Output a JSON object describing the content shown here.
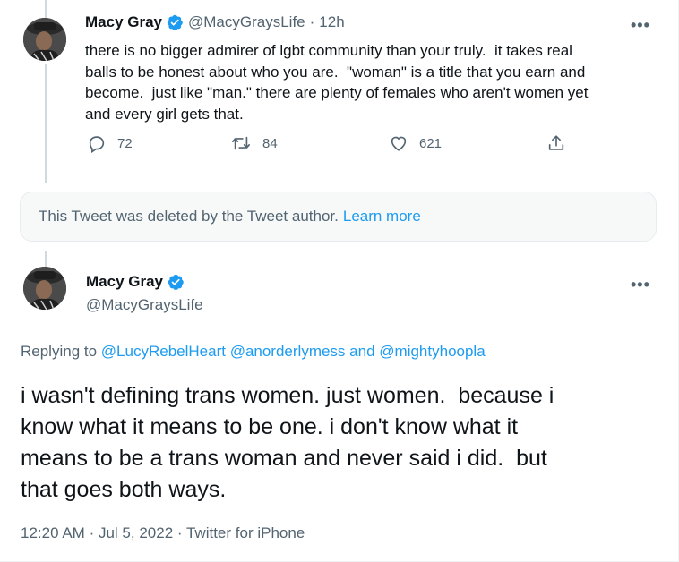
{
  "tweet1": {
    "name": "Macy Gray",
    "handle": "@MacyGraysLife",
    "separator": "·",
    "time": "12h",
    "more": "•••",
    "text_lines": [
      "there is no bigger admirer of lgbt community than your truly.  it takes real",
      "balls to be honest about who you are.  \"woman\" is a title that you earn and",
      "become.  just like \"man.\" there are plenty of females who aren't women yet",
      "and every girl gets that."
    ],
    "replies": "72",
    "retweets": "84",
    "likes": "621"
  },
  "deleted_notice": {
    "text": "This Tweet was deleted by the Tweet author.",
    "link": "Learn more"
  },
  "tweet2": {
    "name": "Macy Gray",
    "handle": "@MacyGraysLife",
    "more": "•••",
    "replying_prefix": "Replying to",
    "reply_to_1": "@LucyRebelHeart",
    "reply_to_2": "@anorderlymess",
    "reply_and": "and",
    "reply_to_3": "@mightyhoopla",
    "text_lines": [
      "i wasn't defining trans women. just women.  because i",
      "know what it means to be one. i don't know what it",
      "means to be a trans woman and never said i did.  but",
      "that goes both ways."
    ],
    "time": "12:20 AM",
    "date": "Jul 5, 2022",
    "source": "Twitter for iPhone",
    "separator": "·"
  },
  "colors": {
    "accent": "#1d9bf0",
    "secondary_text": "#536471",
    "primary_text": "#0f1419"
  },
  "icons": [
    "verified-badge-icon",
    "reply-icon",
    "retweet-icon",
    "like-icon",
    "share-icon",
    "more-icon"
  ]
}
